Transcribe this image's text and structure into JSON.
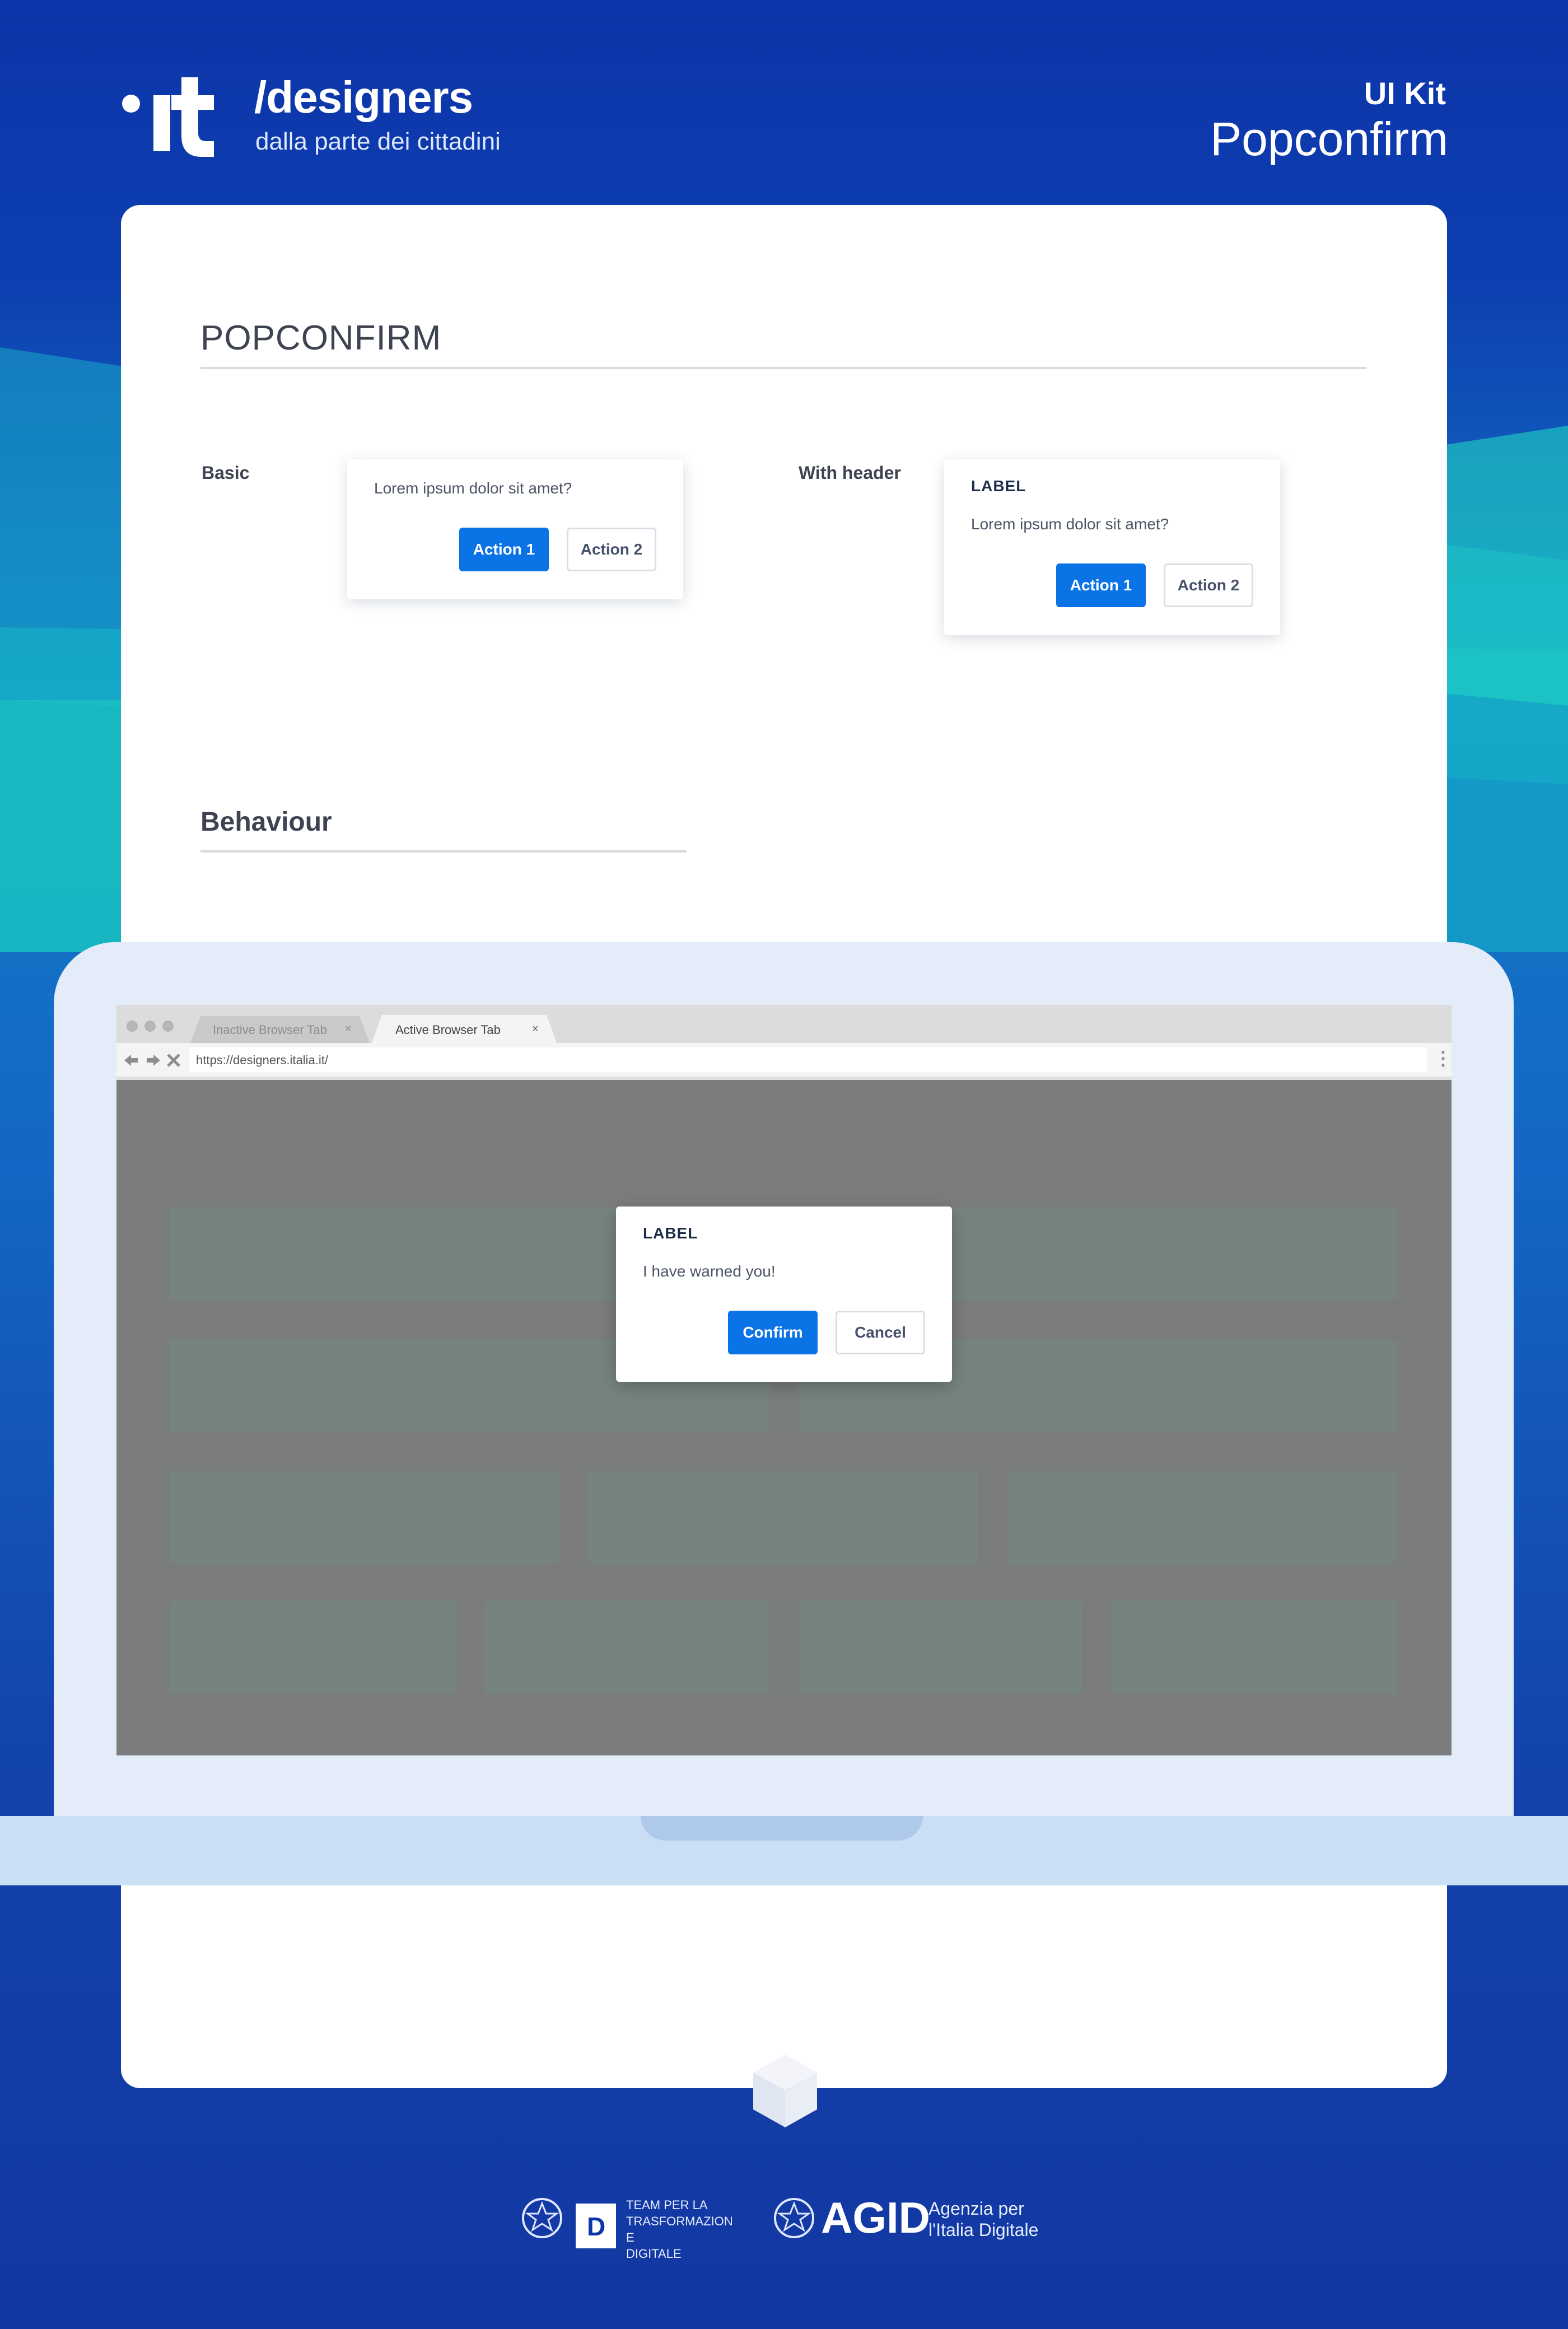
{
  "header": {
    "brand_mark": ".it",
    "brand_title": "/designers",
    "brand_subtitle": "dalla parte dei cittadini",
    "kit_label": "UI Kit",
    "kit_name": "Popconfirm"
  },
  "section": {
    "title": "POPCONFIRM"
  },
  "examples": {
    "basic": {
      "label": "Basic",
      "text": "Lorem ipsum dolor sit amet?",
      "action1": "Action 1",
      "action2": "Action 2"
    },
    "with_header": {
      "label": "With header",
      "header": "LABEL",
      "text": "Lorem ipsum dolor sit amet?",
      "action1": "Action 1",
      "action2": "Action 2"
    }
  },
  "behaviour": {
    "title": "Behaviour"
  },
  "browser": {
    "inactive_tab": "Inactive Browser Tab",
    "active_tab": "Active Browser Tab",
    "tab_close": "×",
    "url": "https://designers.italia.it/",
    "menu_icon": "⋮"
  },
  "modal": {
    "header": "LABEL",
    "text": "I have warned you!",
    "confirm": "Confirm",
    "cancel": "Cancel"
  },
  "footer": {
    "team_line1": "TEAM PER LA",
    "team_line2": "TRASFORMAZION",
    "team_line3": "E",
    "team_line4": "DIGITALE",
    "agid": "AGID",
    "agid_line1": "Agenzia per",
    "agid_line2": "l'Italia Digitale"
  },
  "colors": {
    "primary": "#0a73e6",
    "background_blue": "#0b35a8",
    "teal_accent": "#1ccfc0"
  }
}
